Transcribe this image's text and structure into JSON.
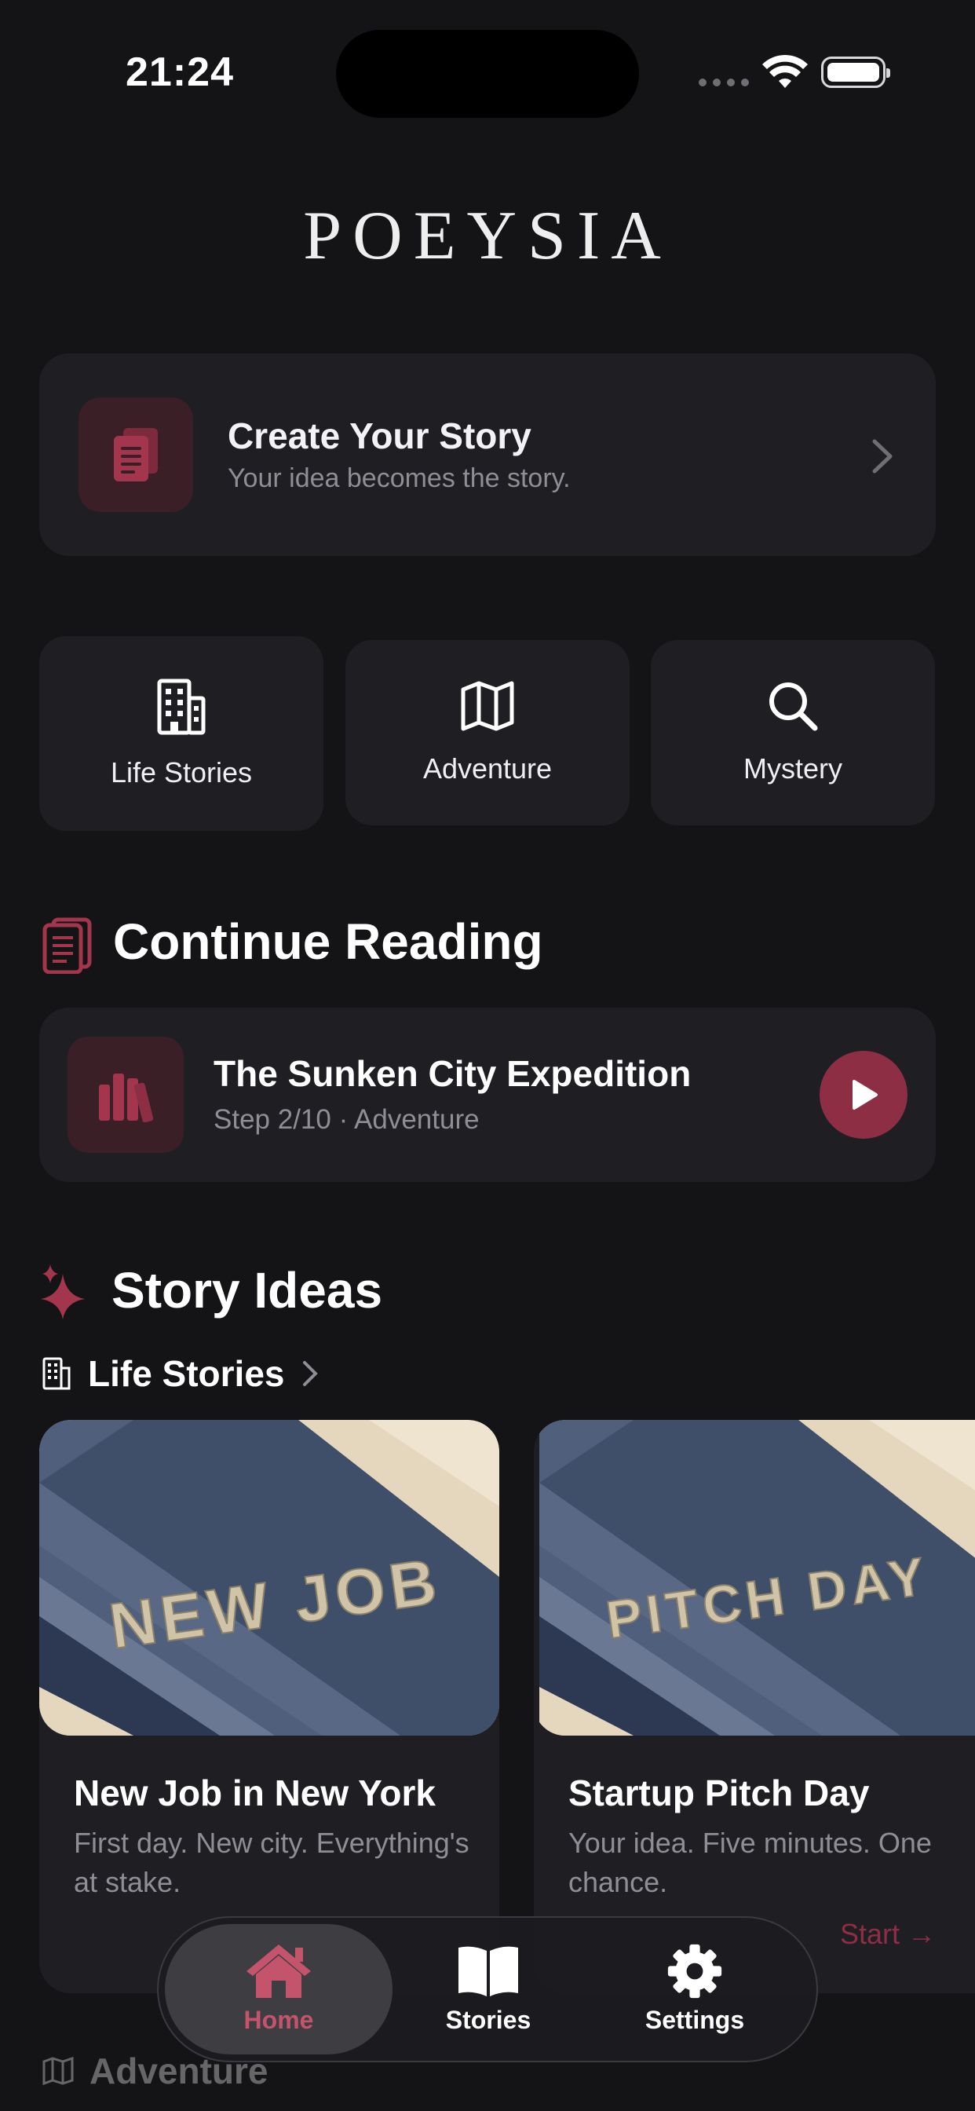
{
  "status_bar": {
    "time": "21:24"
  },
  "app": {
    "logo": "POEYSIA"
  },
  "create_story": {
    "title": "Create Your Story",
    "subtitle": "Your idea becomes the story."
  },
  "categories": [
    {
      "label": "Life Stories",
      "icon": "building-icon"
    },
    {
      "label": "Adventure",
      "icon": "map-icon"
    },
    {
      "label": "Mystery",
      "icon": "search-icon"
    }
  ],
  "continue_reading": {
    "heading": "Continue Reading",
    "item": {
      "title": "The Sunken City Expedition",
      "meta": "Step 2/10 · Adventure"
    }
  },
  "story_ideas": {
    "heading": "Story Ideas",
    "group_label": "Life Stories",
    "cards": [
      {
        "art_text": "NEW JOB",
        "title": "New Job in New York",
        "desc": "First day. New city. Everything's at stake."
      },
      {
        "art_text": "PITCH DAY",
        "title": "Startup Pitch Day",
        "desc": "Your idea. Five minutes. One chance.",
        "cta": "Start →"
      }
    ],
    "next_group_label": "Adventure"
  },
  "tabbar": {
    "items": [
      {
        "label": "Home",
        "icon": "home-icon",
        "active": true
      },
      {
        "label": "Stories",
        "icon": "book-open-icon"
      },
      {
        "label": "Settings",
        "icon": "gear-icon"
      }
    ]
  },
  "colors": {
    "background": "#141416",
    "card": "#1f1f23",
    "accent": "#8e2e45",
    "accent_light": "#c3546b",
    "muted_text": "#8e8e95"
  }
}
